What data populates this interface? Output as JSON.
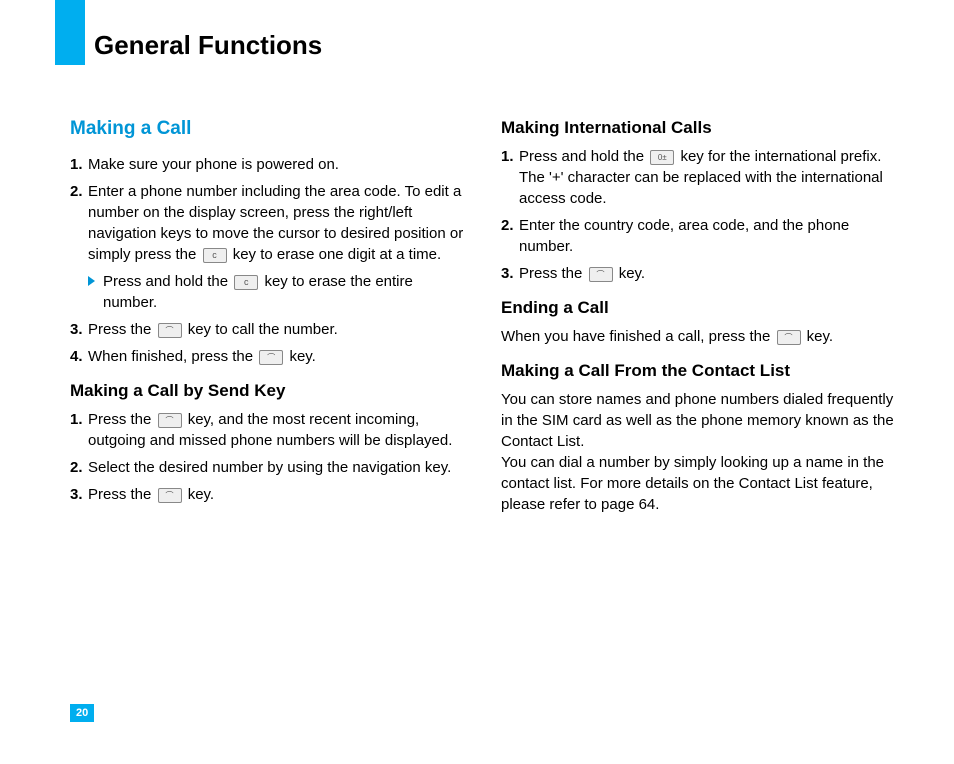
{
  "page": {
    "title": "General Functions",
    "number": "20"
  },
  "left": {
    "heading": "Making a Call",
    "li1": "Make sure your phone is powered on.",
    "li2a": "Enter a phone number including the area code. To edit a number on the display screen, press the right/left navigation keys to move the cursor to desired position or simply press the ",
    "li2b": " key to erase one digit at a time.",
    "bullet_a": "Press and hold the ",
    "bullet_b": " key to erase the entire number.",
    "li3a": "Press the ",
    "li3b": " key to call the number.",
    "li4a": "When finished, press the ",
    "li4b": " key.",
    "sub2": "Making a Call by Send Key",
    "s2li1a": "Press the ",
    "s2li1b": " key, and the most recent incoming, outgoing and missed phone numbers will be displayed.",
    "s2li2": "Select the desired number by using the navigation key.",
    "s2li3a": "Press the ",
    "s2li3b": " key."
  },
  "right": {
    "sub1": "Making International Calls",
    "r1li1a": "Press and hold the ",
    "r1li1b": " key for the international prefix. The '+' character can be replaced with the international access code.",
    "r1li2": "Enter the country code, area code, and the phone number.",
    "r1li3a": "Press the ",
    "r1li3b": " key.",
    "sub2": "Ending a Call",
    "r2pa": "When you have finished a call, press the ",
    "r2pb": " key.",
    "sub3": "Making a Call From the Contact List",
    "r3p": "You can store names and phone numbers dialed frequently in the SIM card as well as the phone memory known as the Contact List.\nYou can dial a number by simply looking up a name in the contact list. For more details on the Contact List feature, please refer to page 64."
  },
  "nums": {
    "n1": "1.",
    "n2": "2.",
    "n3": "3.",
    "n4": "4."
  }
}
